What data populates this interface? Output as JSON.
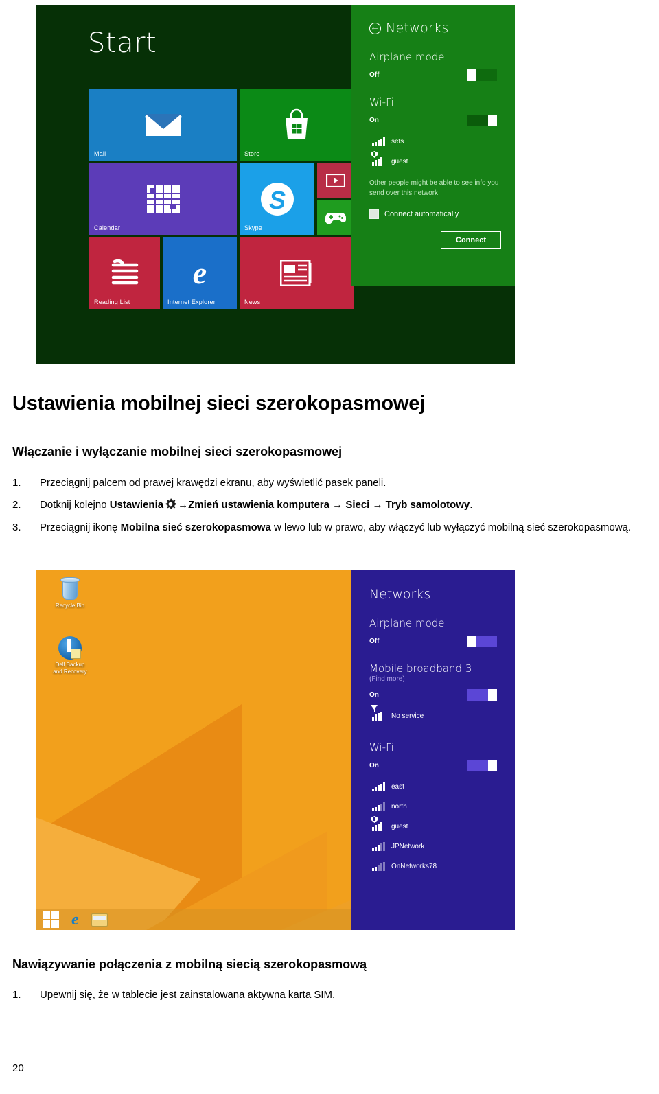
{
  "document": {
    "title": "Ustawienia mobilnej sieci szerokopasmowej",
    "section1_heading": "Włączanie i wyłączanie mobilnej sieci szerokopasmowej",
    "section2_heading": "Nawiązywanie połączenia z mobilną siecią szerokopasmową",
    "page_number": "20",
    "steps": [
      {
        "num": "1.",
        "text_plain": "Przeciągnij palcem od prawej krawędzi ekranu, aby wyświetlić pasek paneli."
      },
      {
        "num": "2.",
        "lead": "Dotknij kolejno ",
        "bold1": "Ustawienia",
        "gear_icon": "gear-icon",
        "bold2": "→Zmień ustawienia komputera → Sieci → Tryb samolotowy",
        "tail": "."
      },
      {
        "num": "3.",
        "lead": "Przeciągnij ikonę ",
        "bold1": "Mobilna sieć szerokopasmowa",
        "tail": " w lewo lub w prawo, aby włączyć lub wyłączyć mobilną sieć szerokopasmową."
      }
    ],
    "steps2": [
      {
        "num": "1.",
        "text_plain": "Upewnij się, że w tablecie jest zainstalowana aktywna karta SIM."
      }
    ]
  },
  "screenshot1": {
    "caption": "Windows 8 Start screen with Networks charm",
    "start_label": "Start",
    "tiles": [
      {
        "name": "Mail",
        "icon": "mail-icon",
        "color": "#1a7fc4"
      },
      {
        "name": "Store",
        "icon": "store-icon",
        "color": "#0b8a16"
      },
      {
        "name": "Calendar",
        "icon": "calendar-icon",
        "color": "#5c3cb8"
      },
      {
        "name": "Skype",
        "icon": "skype-icon",
        "color": "#1ba0e8"
      },
      {
        "name": "",
        "icon": "video-icon",
        "color": "#b82d46"
      },
      {
        "name": "",
        "icon": "xbox-icon",
        "color": "#1f9c1f"
      },
      {
        "name": "Reading List",
        "icon": "reading-icon",
        "color": "#c0253f"
      },
      {
        "name": "Internet Explorer",
        "icon": "ie-icon",
        "color": "#1a6fc9"
      },
      {
        "name": "News",
        "icon": "news-icon",
        "color": "#c0253f"
      }
    ],
    "charm": {
      "title": "Networks",
      "back_icon": "back-arrow-icon",
      "airplane": {
        "label": "Airplane mode",
        "state": "Off"
      },
      "wifi": {
        "label": "Wi-Fi",
        "state": "On"
      },
      "networks": [
        {
          "name": "sets",
          "secured": false
        },
        {
          "name": "guest",
          "secured": true
        }
      ],
      "hint": "Other people might be able to see info you send over this network",
      "connect_automatically": "Connect automatically",
      "connect_button": "Connect",
      "accent": "#168016"
    }
  },
  "screenshot2": {
    "caption": "Windows 8 desktop with Networks charm showing mobile broadband",
    "desktop_icons": [
      {
        "label": "Recycle Bin",
        "icon": "recycle-bin-icon"
      },
      {
        "label": "Dell Backup\nand Recovery",
        "icon": "dell-backup-icon"
      }
    ],
    "desktop_icon_labels": [
      "Recycle Bin",
      "Dell Backup",
      "and Recovery"
    ],
    "taskbar": [
      {
        "label": "Start",
        "icon": "windows-start-icon"
      },
      {
        "label": "Internet Explorer",
        "icon": "ie-icon"
      },
      {
        "label": "File Explorer",
        "icon": "folder-icon"
      }
    ],
    "charm": {
      "title": "Networks",
      "airplane": {
        "label": "Airplane mode",
        "state": "Off"
      },
      "mobile_broadband": {
        "label": "Mobile broadband 3",
        "sub": "(Find more)",
        "state": "On",
        "status": "No service"
      },
      "wifi": {
        "label": "Wi-Fi",
        "state": "On"
      },
      "networks": [
        {
          "name": "east",
          "secured": false
        },
        {
          "name": "north",
          "secured": false
        },
        {
          "name": "guest",
          "secured": true
        },
        {
          "name": "JPNetwork",
          "secured": false
        },
        {
          "name": "OnNetworks78",
          "secured": false
        }
      ],
      "accent": "#2a1c91"
    }
  }
}
